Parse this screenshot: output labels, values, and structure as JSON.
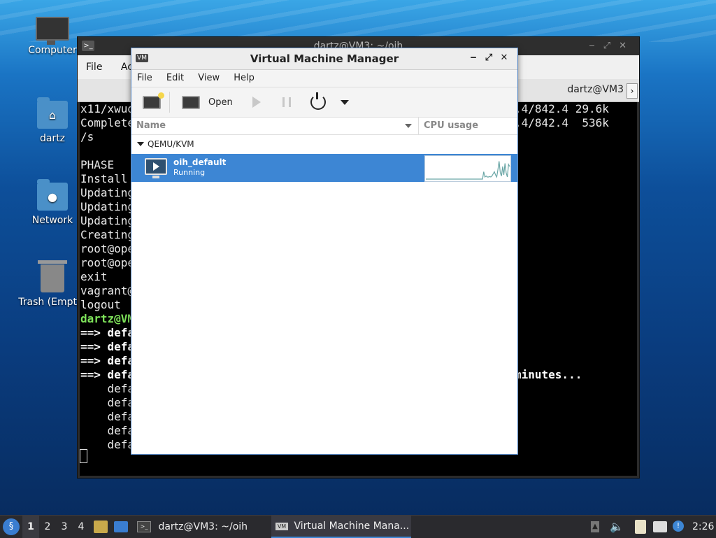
{
  "desktop": {
    "icons": [
      {
        "label": "Computer"
      },
      {
        "label": "dartz"
      },
      {
        "label": "Network"
      },
      {
        "label": "Trash (Empty)"
      }
    ]
  },
  "terminal": {
    "title": "dartz@VM3: ~/oih",
    "menu": [
      "File",
      "Acti"
    ],
    "tab_title": "dartz@VM3",
    "lines": [
      "x11/xwud",
      "Complete",
      "/s",
      "",
      "PHASE",
      "Install",
      "Updating",
      "Updating",
      "Updating",
      "Creating",
      "root@ope",
      "root@ope",
      "exit",
      "vagrant@",
      "logout",
      "dartz@VM",
      "==> defa",
      "==> defa",
      "==> defa",
      "==> defa",
      "    defa",
      "    defa",
      "    defa",
      "    defa",
      "    defa"
    ],
    "right_lines": [
      ".4/842.4 29.6k",
      ".4/842.4  536k"
    ],
    "minutes_text": "minutes..."
  },
  "vmm": {
    "title": "Virtual Machine Manager",
    "menu": {
      "file": "File",
      "edit": "Edit",
      "view": "View",
      "help": "Help"
    },
    "toolbar": {
      "open_label": "Open"
    },
    "columns": {
      "name": "Name",
      "cpu": "CPU usage"
    },
    "group": "QEMU/KVM",
    "vm": {
      "name": "oih_default",
      "status": "Running"
    },
    "cpu_history": [
      0,
      0,
      0,
      0,
      0,
      0,
      0,
      0,
      0,
      0,
      0,
      0,
      0,
      0,
      0,
      0,
      0,
      0,
      0,
      0,
      0,
      0,
      0,
      0,
      0,
      0,
      0,
      0,
      0,
      0,
      0,
      0,
      0,
      0,
      0,
      0,
      0,
      0,
      0,
      0,
      0,
      0,
      0,
      0,
      0,
      0,
      0,
      0,
      0,
      0.35,
      0.1,
      0.15,
      0.1,
      0.1,
      0.12,
      0.1,
      0.15,
      0.25,
      0.35,
      0.2,
      0.1,
      0.45,
      0.85,
      0.3,
      0.15,
      0.6,
      0.2,
      0.75,
      0.3,
      0.1,
      0.7,
      0.6
    ]
  },
  "taskbar": {
    "workspaces": [
      "1",
      "2",
      "3",
      "4"
    ],
    "tasks": [
      {
        "label": "dartz@VM3: ~/oih"
      },
      {
        "label": "Virtual Machine Mana..."
      }
    ],
    "clock": "2:26"
  }
}
